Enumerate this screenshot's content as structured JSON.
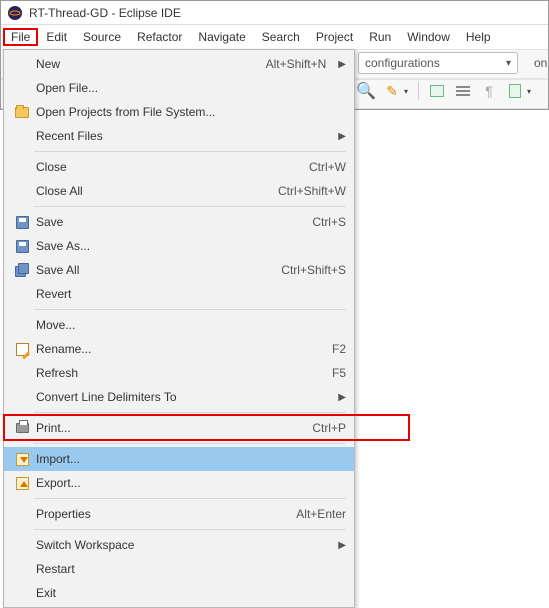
{
  "titlebar": {
    "title": "RT-Thread-GD - Eclipse IDE"
  },
  "menubar": {
    "items": [
      {
        "label": "File",
        "active": true
      },
      {
        "label": "Edit"
      },
      {
        "label": "Source"
      },
      {
        "label": "Refactor"
      },
      {
        "label": "Navigate"
      },
      {
        "label": "Search"
      },
      {
        "label": "Project"
      },
      {
        "label": "Run"
      },
      {
        "label": "Window"
      },
      {
        "label": "Help"
      }
    ]
  },
  "config_dropdown": {
    "label": "configurations"
  },
  "toolbar_suffix": "on",
  "file_menu": {
    "groups": [
      [
        {
          "label": "New",
          "accel": "Alt+Shift+N",
          "submenu": true,
          "icon": ""
        },
        {
          "label": "Open File...",
          "icon": ""
        },
        {
          "label": "Open Projects from File System...",
          "icon": "folder"
        },
        {
          "label": "Recent Files",
          "submenu": true,
          "icon": ""
        }
      ],
      [
        {
          "label": "Close",
          "accel": "Ctrl+W",
          "icon": ""
        },
        {
          "label": "Close All",
          "accel": "Ctrl+Shift+W",
          "icon": ""
        }
      ],
      [
        {
          "label": "Save",
          "accel": "Ctrl+S",
          "icon": "save"
        },
        {
          "label": "Save As...",
          "icon": "save"
        },
        {
          "label": "Save All",
          "accel": "Ctrl+Shift+S",
          "icon": "saveall"
        },
        {
          "label": "Revert",
          "icon": ""
        }
      ],
      [
        {
          "label": "Move...",
          "icon": ""
        },
        {
          "label": "Rename...",
          "accel": "F2",
          "icon": "rename"
        },
        {
          "label": "Refresh",
          "accel": "F5",
          "icon": ""
        },
        {
          "label": "Convert Line Delimiters To",
          "submenu": true,
          "icon": ""
        }
      ],
      [
        {
          "label": "Print...",
          "accel": "Ctrl+P",
          "icon": "print"
        }
      ],
      [
        {
          "label": "Import...",
          "icon": "import",
          "hover": true
        },
        {
          "label": "Export...",
          "icon": "export"
        }
      ],
      [
        {
          "label": "Properties",
          "accel": "Alt+Enter",
          "icon": ""
        }
      ],
      [
        {
          "label": "Switch Workspace",
          "submenu": true,
          "icon": ""
        },
        {
          "label": "Restart",
          "icon": ""
        },
        {
          "label": "Exit",
          "icon": ""
        }
      ]
    ]
  }
}
